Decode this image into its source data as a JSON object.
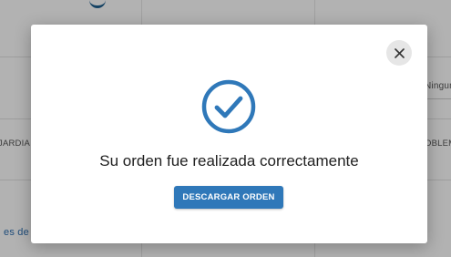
{
  "background": {
    "field_value_partial": "Ningun",
    "column_left_partial": "JARDIA",
    "column_right_partial": "OBLEM",
    "link_partial": "es de"
  },
  "modal": {
    "close_icon": "close-icon",
    "status_icon": "check-circle-icon",
    "message": "Su orden fue realizada correctamente",
    "download_button_label": "DESCARGAR ORDEN"
  },
  "colors": {
    "accent": "#2F78B9",
    "overlay": "rgba(0,0,0,0.30)"
  }
}
